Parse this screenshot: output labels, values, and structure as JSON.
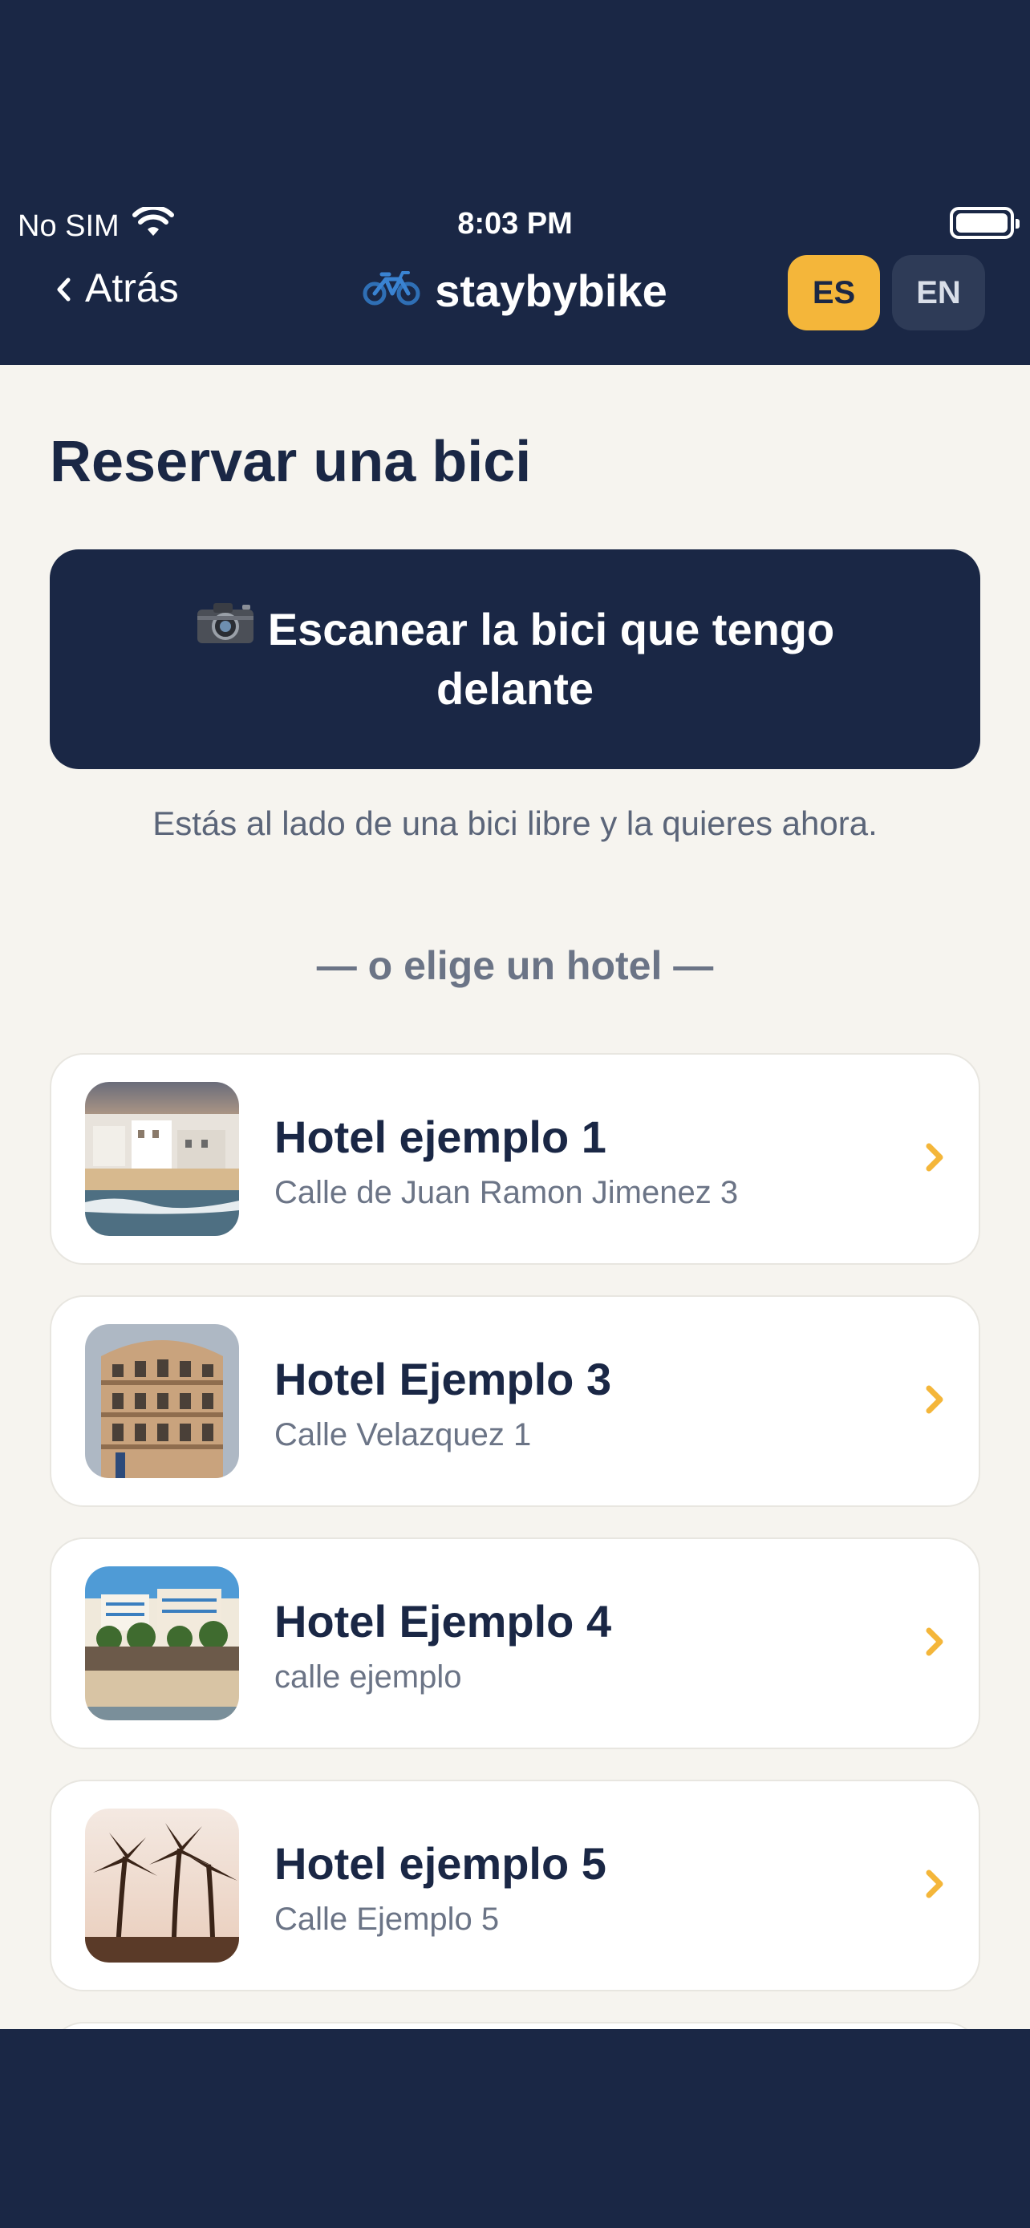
{
  "status_bar": {
    "carrier": "No SIM",
    "time": "8:03 PM"
  },
  "nav": {
    "back_label": "Atrás",
    "app_name": "staybybike",
    "lang_es": "ES",
    "lang_en": "EN",
    "active_lang": "ES"
  },
  "page": {
    "title": "Reservar una bici",
    "scan_button_line1": "Escanear la bici que tengo",
    "scan_button_line2": "delante",
    "scan_hint": "Estás al lado de una bici libre y la quieres ahora.",
    "divider": "— o elige un hotel —"
  },
  "hotels": [
    {
      "name": "Hotel ejemplo 1",
      "address": "Calle de Juan Ramon Jimenez 3"
    },
    {
      "name": "Hotel Ejemplo 3",
      "address": "Calle Velazquez 1"
    },
    {
      "name": "Hotel Ejemplo 4",
      "address": "calle ejemplo"
    },
    {
      "name": "Hotel ejemplo 5",
      "address": "Calle Ejemplo 5"
    }
  ],
  "colors": {
    "navy": "#1a2745",
    "accent": "#f4b63a",
    "background": "#f6f4ef"
  },
  "icons": {
    "scan_icon": "camera-icon",
    "app_icon": "bicycle-icon",
    "chevron": "chevron-right-icon"
  }
}
